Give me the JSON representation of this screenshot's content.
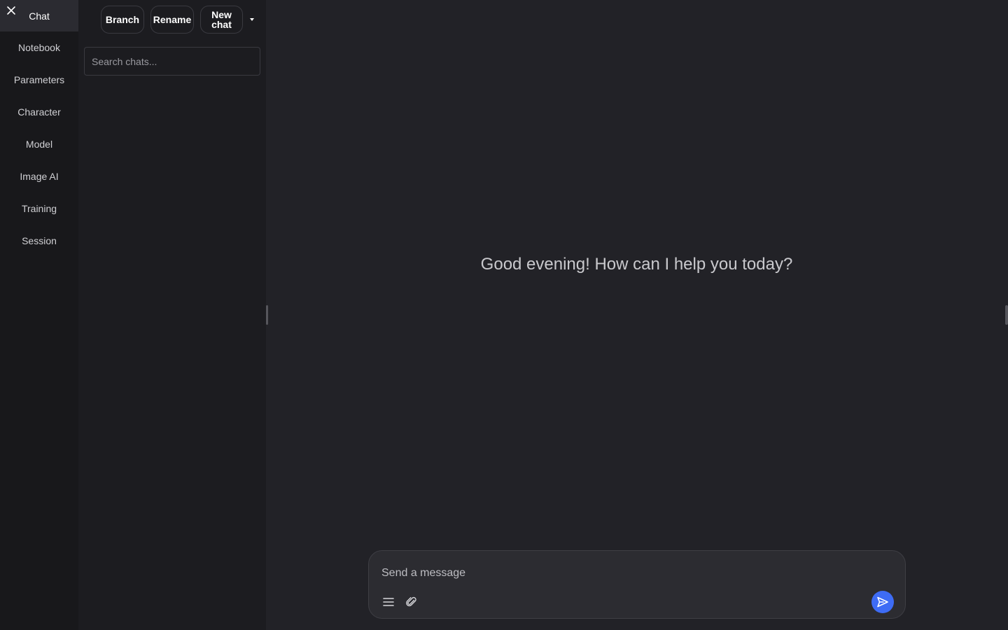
{
  "nav": {
    "items": [
      {
        "label": "Chat",
        "active": true
      },
      {
        "label": "Notebook"
      },
      {
        "label": "Parameters"
      },
      {
        "label": "Character"
      },
      {
        "label": "Model"
      },
      {
        "label": "Image AI"
      },
      {
        "label": "Training"
      },
      {
        "label": "Session"
      }
    ],
    "close_icon": "close-icon"
  },
  "chat_panel": {
    "branch_label": "Branch",
    "rename_label": "Rename",
    "new_chat_label": "New\nchat",
    "dropdown_icon": "caret-down-icon",
    "search_placeholder": "Search chats..."
  },
  "main": {
    "greeting": "Good evening! How can I help you today?"
  },
  "composer": {
    "placeholder": "Send a message",
    "menu_icon": "hamburger-menu-icon",
    "attach_icon": "paperclip-icon",
    "send_icon": "send-icon"
  },
  "colors": {
    "background": "#222227",
    "nav_background": "#18181b",
    "panel_background": "#1c1c20",
    "accent": "#3e6cf5"
  }
}
